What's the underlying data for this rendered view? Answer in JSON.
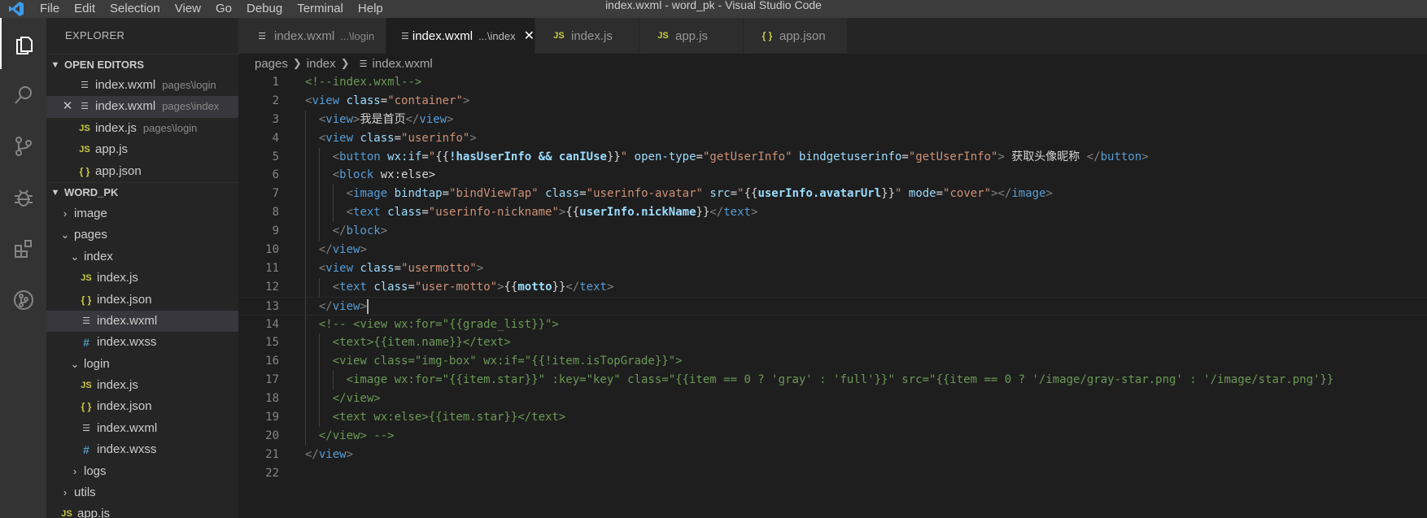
{
  "window": {
    "title": "index.wxml - word_pk - Visual Studio Code"
  },
  "menu": [
    "File",
    "Edit",
    "Selection",
    "View",
    "Go",
    "Debug",
    "Terminal",
    "Help"
  ],
  "activity": [
    "files-icon",
    "search-icon",
    "source-control-icon",
    "debug-icon",
    "extensions-icon",
    "git-graph-icon"
  ],
  "sidebar": {
    "title": "EXPLORER",
    "open_editors_label": "OPEN EDITORS",
    "open_editors": [
      {
        "name": "index.wxml",
        "desc": "pages\\login",
        "icon": "wxml"
      },
      {
        "name": "index.wxml",
        "desc": "pages\\index",
        "icon": "wxml"
      },
      {
        "name": "index.js",
        "desc": "pages\\login",
        "icon": "js"
      },
      {
        "name": "app.js",
        "desc": "",
        "icon": "js"
      },
      {
        "name": "app.json",
        "desc": "",
        "icon": "json"
      }
    ],
    "project_label": "WORD_PK",
    "tree": [
      {
        "name": "image",
        "type": "folder",
        "open": false,
        "depth": 0
      },
      {
        "name": "pages",
        "type": "folder",
        "open": true,
        "depth": 0
      },
      {
        "name": "index",
        "type": "folder",
        "open": true,
        "depth": 1
      },
      {
        "name": "index.js",
        "type": "js",
        "depth": 2
      },
      {
        "name": "index.json",
        "type": "json",
        "depth": 2
      },
      {
        "name": "index.wxml",
        "type": "wxml",
        "depth": 2,
        "selected": true
      },
      {
        "name": "index.wxss",
        "type": "css",
        "depth": 2
      },
      {
        "name": "login",
        "type": "folder",
        "open": true,
        "depth": 1
      },
      {
        "name": "index.js",
        "type": "js",
        "depth": 2
      },
      {
        "name": "index.json",
        "type": "json",
        "depth": 2
      },
      {
        "name": "index.wxml",
        "type": "wxml",
        "depth": 2
      },
      {
        "name": "index.wxss",
        "type": "css",
        "depth": 2
      },
      {
        "name": "logs",
        "type": "folder",
        "open": false,
        "depth": 1
      },
      {
        "name": "utils",
        "type": "folder",
        "open": false,
        "depth": 0
      },
      {
        "name": "app.js",
        "type": "js",
        "depth": 0
      }
    ]
  },
  "tabs": [
    {
      "name": "index.wxml",
      "desc": "...\\login",
      "icon": "wxml"
    },
    {
      "name": "index.wxml",
      "desc": "...\\index",
      "icon": "wxml",
      "active": true
    },
    {
      "name": "index.js",
      "desc": "",
      "icon": "js"
    },
    {
      "name": "app.js",
      "desc": "",
      "icon": "js"
    },
    {
      "name": "app.json",
      "desc": "",
      "icon": "json"
    }
  ],
  "breadcrumb": [
    "pages",
    "index",
    "index.wxml"
  ],
  "editor": {
    "lines": [
      "<!--index.wxml-->",
      "<view class=\"container\">",
      "  <view>我是首页</view>",
      "  <view class=\"userinfo\">",
      "    <button wx:if=\"{{!hasUserInfo && canIUse}}\" open-type=\"getUserInfo\" bindgetuserinfo=\"getUserInfo\"> 获取头像昵称 </button>",
      "    <block wx:else>",
      "      <image bindtap=\"bindViewTap\" class=\"userinfo-avatar\" src=\"{{userInfo.avatarUrl}}\" mode=\"cover\"></image>",
      "      <text class=\"userinfo-nickname\">{{userInfo.nickName}}</text>",
      "    </block>",
      "  </view>",
      "  <view class=\"usermotto\">",
      "    <text class=\"user-motto\">{{motto}}</text>",
      "  </view>",
      "  <!-- <view wx:for=\"{{grade_list}}\">",
      "    <text>{{item.name}}</text>",
      "    <view class=\"img-box\" wx:if=\"{{!item.isTopGrade}}\">",
      "      <image wx:for=\"{{item.star}}\" :key=\"key\" class=\"{{item == 0 ? 'gray' : 'full'}}\" src=\"{{item == 0 ? '/image/gray-star.png' : '/image/star.png'}}",
      "    </view>",
      "    <text wx:else>{{item.star}}</text>",
      "  </view> -->",
      "</view>",
      ""
    ]
  }
}
